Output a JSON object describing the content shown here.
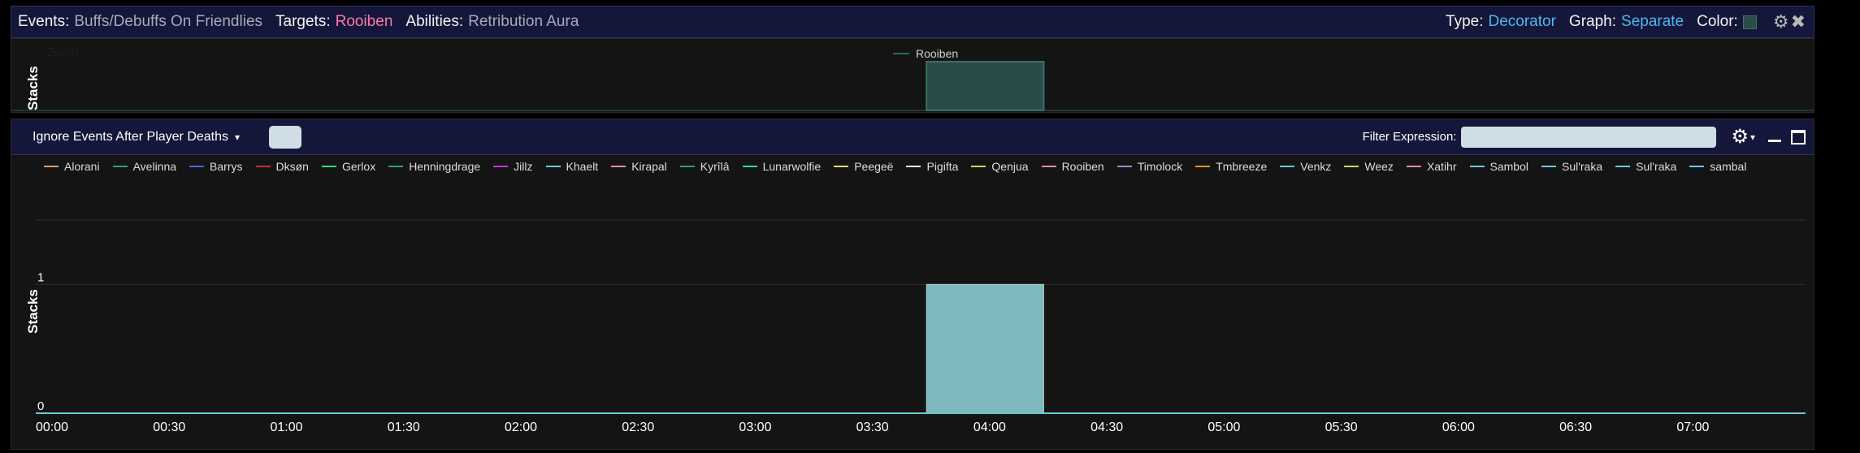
{
  "topbar": {
    "events_label": "Events:",
    "events_value": "Buffs/Debuffs On Friendlies",
    "targets_label": "Targets:",
    "targets_value": "Rooiben",
    "abilities_label": "Abilities:",
    "abilities_value": "Retribution Aura",
    "type_label": "Type:",
    "type_value": "Decorator",
    "graph_label": "Graph:",
    "graph_value": "Separate",
    "color_label": "Color:",
    "color_swatch": "#2a4b48",
    "gear_icon": "⚙",
    "close_icon": "✖"
  },
  "zoom": {
    "label": "Zoom",
    "ylabel": "Stacks",
    "legend_name": "Rooiben",
    "legend_color": "#2a6b62"
  },
  "main": {
    "ignore_label": "Ignore Events After Player Deaths",
    "caret": "▾",
    "filter_label": "Filter Expression:",
    "filter_value": "",
    "gear_icon": "⚙",
    "legend": [
      {
        "name": "Alorani",
        "color": "#e0a060"
      },
      {
        "name": "Avelinna",
        "color": "#2fa36b"
      },
      {
        "name": "Barrys",
        "color": "#3b6cf0"
      },
      {
        "name": "Dksøn",
        "color": "#d02a36"
      },
      {
        "name": "Gerlox",
        "color": "#2fe07a"
      },
      {
        "name": "Henningdrage",
        "color": "#2f9e7a"
      },
      {
        "name": "Jillz",
        "color": "#c03ad8"
      },
      {
        "name": "Khaelt",
        "color": "#6cc8f0"
      },
      {
        "name": "Kirapal",
        "color": "#f08aa8"
      },
      {
        "name": "Kyrîlâ",
        "color": "#2fa06b"
      },
      {
        "name": "Lunarwolfie",
        "color": "#2fe0a0"
      },
      {
        "name": "Peegeë",
        "color": "#f0e070"
      },
      {
        "name": "Pigifta",
        "color": "#f2f2f2"
      },
      {
        "name": "Qenjua",
        "color": "#c8d860"
      },
      {
        "name": "Rooiben",
        "color": "#f08aa8"
      },
      {
        "name": "Timolock",
        "color": "#9a88d8"
      },
      {
        "name": "Tmbreeze",
        "color": "#f0902a"
      },
      {
        "name": "Venkz",
        "color": "#6cc8f0"
      },
      {
        "name": "Weez",
        "color": "#c8d860"
      },
      {
        "name": "Xatihr",
        "color": "#f08aa8"
      },
      {
        "name": "Sambol",
        "color": "#6cc8f0"
      },
      {
        "name": "Sul'raka",
        "color": "#6cc8f0"
      },
      {
        "name": "Sul'raka",
        "color": "#6cc8f0"
      },
      {
        "name": "sambal",
        "color": "#6cc8f0"
      }
    ]
  },
  "chart_data": [
    {
      "type": "area",
      "ylabel": "Stacks",
      "xlim": [
        "00:00",
        "07:33"
      ],
      "series": [
        {
          "name": "Rooiben",
          "color": "#2a4b48",
          "segments": [
            {
              "start": "03:48",
              "end": "04:18",
              "value": 1
            }
          ]
        }
      ]
    },
    {
      "type": "area",
      "ylabel": "Stacks",
      "xlim": [
        "00:00",
        "07:33"
      ],
      "ylim": [
        0,
        1.5
      ],
      "yticks": [
        "0",
        "1"
      ],
      "xticks": [
        "00:00",
        "00:30",
        "01:00",
        "01:30",
        "02:00",
        "02:30",
        "03:00",
        "03:30",
        "04:00",
        "04:30",
        "05:00",
        "05:30",
        "06:00",
        "06:30",
        "07:00"
      ],
      "grid": true,
      "series": [
        {
          "name": "Rooiben",
          "color": "#7fb8bd",
          "segments": [
            {
              "start": "03:48",
              "end": "04:18",
              "value": 1
            }
          ]
        }
      ]
    }
  ]
}
